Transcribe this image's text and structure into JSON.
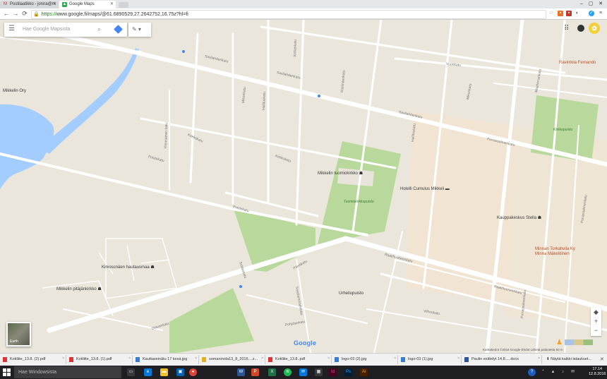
{
  "browser": {
    "tabs": [
      {
        "label": "Postilaatikko - jonna@m",
        "icon": "gmail-icon"
      },
      {
        "label": "Google Maps",
        "icon": "maps-icon"
      }
    ],
    "window_controls": [
      "–",
      "▢",
      "✕"
    ],
    "url": "https://www.google.fi/maps/@61.6890529,27.2642752,16.75z?hl=fi",
    "url_prefix": "https://",
    "url_rest": "www.google.fi/maps/@61.6890529,27.2642752,16.75z?hl=fi",
    "nav_glyphs": {
      "back": "←",
      "forward": "→",
      "reload": "⟳"
    }
  },
  "maps": {
    "search_placeholder": "Hae Google Mapsista",
    "edit_glyph": "✎ ▾",
    "earth_label": "Earth",
    "google_logo": "Google",
    "footer": "Karttatiedot ©2016 Google   Ehdot   Lähetä palautetta      50 m",
    "zoom": {
      "in": "+",
      "out": "−",
      "compass": "◆"
    },
    "labels": {
      "places": [
        {
          "text": "Mikkelin tuomiokirkko",
          "cls": "poi",
          "icon": "church-icon"
        },
        {
          "text": "Hotelli Cumulus Mikkeli",
          "cls": "poi",
          "icon": "hotel-icon"
        },
        {
          "text": "Kauppakeskus Stella",
          "cls": "poi",
          "icon": "mall-icon"
        },
        {
          "text": "Minnan Torkahvila Ky\nMinna Mäkelöinen",
          "cls": "poi brown",
          "icon": "food-icon"
        },
        {
          "text": "Ravintola Fernando",
          "cls": "poi brown",
          "icon": "restaurant-icon"
        },
        {
          "text": "Kirkoscnäen hautausmaa",
          "cls": "poi",
          "icon": "cemetery-icon"
        },
        {
          "text": "Mikkelin pitäjänkirkko",
          "cls": "poi",
          "icon": "church-icon"
        },
        {
          "text": "Urheilupuisto",
          "cls": "poi",
          "icon": "park-icon"
        },
        {
          "text": "Mikkelin Ory",
          "cls": "poi",
          "icon": "place-icon"
        }
      ],
      "parks": [
        "Tuomiokirkkopuisto",
        "Kirkkopuisto"
      ],
      "streets": [
        "Savilahdenkatu",
        "Savilahdenkatu",
        "Savilahdenkatu",
        "Porrassalmenkatu",
        "Puistokatu",
        "Puistokatu",
        "Vuorikatu",
        "Mikonkatu",
        "Maaherrankatu",
        "Porrassalmenkatu",
        "Raatihuoneenkatu",
        "Hallituskatu",
        "Otavankatu",
        "Päiväkatu",
        "Raatihuoneenkatu",
        "Sotilaskatu",
        "Saastamoisenkatu",
        "Pohjolankatu",
        "Kirkkokatu",
        "Kirkkokatu",
        "Hallituskatu",
        "Mikonkatu",
        "Porrassalmenkatu",
        "Vilhonkatu",
        "Sotkankatu",
        "Ristimäenkatu",
        "Ylimmäinen katu"
      ]
    }
  },
  "downloads": {
    "items": [
      {
        "label": "Kotiliite_13.8. (2).pdf",
        "type": "pdf"
      },
      {
        "label": "Kotiliite_13.8. (1).pdf",
        "type": "pdf"
      },
      {
        "label": "Kauttaseinätu 17 kesä.jpg",
        "type": "img"
      },
      {
        "label": "somaninola13_8_2016....z...",
        "type": "zip"
      },
      {
        "label": "Kotiliite_13.8..pdf",
        "type": "pdf"
      },
      {
        "label": "logo-03 (2).jpg",
        "type": "img"
      },
      {
        "label": "logo-03 (1).jpg",
        "type": "img"
      },
      {
        "label": "Paulin esittelyt 14.8.....docx",
        "type": "doc"
      }
    ],
    "show_all": "Näytä kaikki lataukset...",
    "close_glyph": "✕"
  },
  "taskbar": {
    "search_placeholder": "Hae Windowsista",
    "time": "17.14",
    "date": "12.8.2016",
    "apps": [
      {
        "name": "task-view-icon",
        "color": "#3a3a3e",
        "glyph": "▭"
      },
      {
        "name": "edge-icon",
        "color": "#0078d7",
        "glyph": "e"
      },
      {
        "name": "file-explorer-icon",
        "color": "#f0c030",
        "glyph": "▬"
      },
      {
        "name": "store-icon",
        "color": "#0063b1",
        "glyph": "▣"
      },
      {
        "name": "chrome-icon",
        "color": "#db4437",
        "glyph": "●"
      },
      {
        "name": "word-icon",
        "color": "#2b5797",
        "glyph": "W"
      },
      {
        "name": "powerpoint-icon",
        "color": "#d24726",
        "glyph": "P"
      },
      {
        "name": "excel-icon",
        "color": "#1e7145",
        "glyph": "X"
      },
      {
        "name": "spotify-icon",
        "color": "#1db954",
        "glyph": "≋"
      },
      {
        "name": "mail-icon",
        "color": "#0078d7",
        "glyph": "✉"
      },
      {
        "name": "photoshop-icon",
        "color": "#001d34",
        "glyph": "Ps"
      },
      {
        "name": "indesign-icon",
        "color": "#49021f",
        "glyph": "Id"
      },
      {
        "name": "photoshop2-icon",
        "color": "#001d34",
        "glyph": "Ps"
      },
      {
        "name": "illustrator-icon",
        "color": "#4a2000",
        "glyph": "Ai"
      }
    ],
    "tray": [
      "?",
      "⌃",
      "▲",
      "♪",
      "✉"
    ]
  },
  "colors": {
    "map_bg": "#ebe6dc",
    "road": "#ffffff",
    "park": "#b9d99c",
    "water": "#a3ccff",
    "commercial": "#f6e6d2"
  }
}
